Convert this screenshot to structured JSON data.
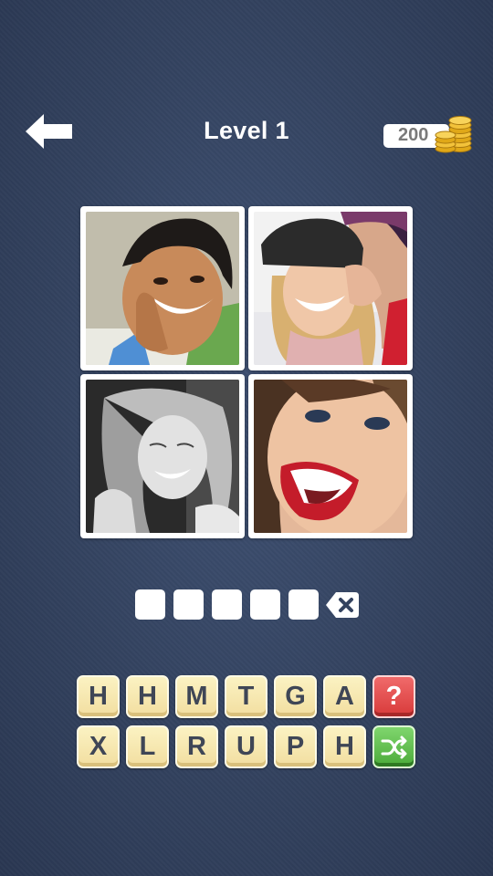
{
  "header": {
    "title": "Level 1",
    "coins": "200"
  },
  "puzzle": {
    "images": [
      {
        "subject": "boy laughing covering mouth"
      },
      {
        "subject": "girl in cap whispered to by boy"
      },
      {
        "subject": "woman laughing black and white"
      },
      {
        "subject": "woman laughing close-up"
      }
    ],
    "answer_slots": 5,
    "answer_letters": [
      "",
      "",
      "",
      "",
      ""
    ]
  },
  "keyboard": {
    "row1": [
      "H",
      "H",
      "M",
      "T",
      "G",
      "A"
    ],
    "row2": [
      "X",
      "L",
      "R",
      "U",
      "P",
      "H"
    ],
    "hint_label": "?",
    "shuffle_icon": "shuffle-icon"
  },
  "colors": {
    "background": "#33425f",
    "key_face": "#f6e6ae",
    "hint": "#e04848",
    "shuffle": "#5bb947"
  }
}
